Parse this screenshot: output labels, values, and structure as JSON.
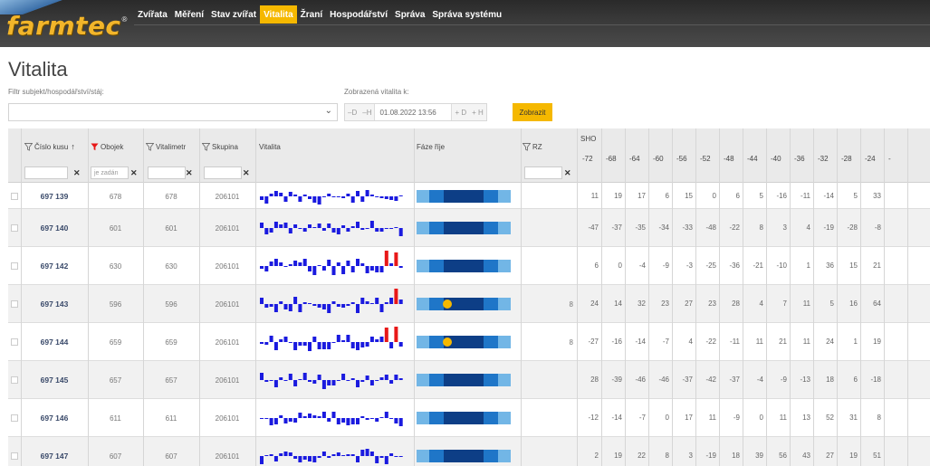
{
  "app": {
    "logo": "farmtec",
    "logo_mark": "®"
  },
  "nav": [
    {
      "label": "Zvířata",
      "active": false
    },
    {
      "label": "Měření",
      "active": false
    },
    {
      "label": "Stav zvířat",
      "active": false
    },
    {
      "label": "Vitalita",
      "active": true
    },
    {
      "label": "Žraní",
      "active": false
    },
    {
      "label": "Hospodářství",
      "active": false
    },
    {
      "label": "Správa",
      "active": false
    },
    {
      "label": "Správa systému",
      "active": false
    }
  ],
  "page": {
    "title": "Vitalita",
    "filter_label": "Filtr subjekt/hospodářství/stáj:",
    "filter_value": "",
    "shown_label": "Zobrazená vitalita k:",
    "date_prev_day": "D",
    "date_prev_hour": "H",
    "date_value": "01.08.2022 13:56",
    "date_next_day": "+ D",
    "date_next_hour": "+ H",
    "show_button": "Zobrazit"
  },
  "table": {
    "headers": {
      "id": "Číslo kusu",
      "sort_arrow": "↑",
      "collar": "Obojek",
      "vitalimeter": "Vitalimetr",
      "group": "Skupina",
      "vitality": "Vitalita",
      "phase": "Fáze říje",
      "rz": "RZ",
      "sho": "SHO"
    },
    "filters": {
      "id": "",
      "collar": "je zadán",
      "vitalimeter": "",
      "group": "",
      "rz": ""
    },
    "sho_columns": [
      "-72",
      "-68",
      "-64",
      "-60",
      "-56",
      "-52",
      "-48",
      "-44",
      "-40",
      "-36",
      "-32",
      "-28",
      "-24",
      "-"
    ],
    "rows": [
      {
        "id": "697 139",
        "collar": "678",
        "vitalimeter": "678",
        "group": "206101",
        "rz": "",
        "dot": false,
        "sho": [
          "11",
          "19",
          "17",
          "6",
          "15",
          "0",
          "6",
          "5",
          "-16",
          "-11",
          "-14",
          "5",
          "33"
        ]
      },
      {
        "id": "697 140",
        "collar": "601",
        "vitalimeter": "601",
        "group": "206101",
        "rz": "",
        "dot": false,
        "sho": [
          "-47",
          "-37",
          "-35",
          "-34",
          "-33",
          "-48",
          "-22",
          "8",
          "3",
          "4",
          "-19",
          "-28",
          "-8"
        ]
      },
      {
        "id": "697 142",
        "collar": "630",
        "vitalimeter": "630",
        "group": "206101",
        "rz": "",
        "dot": false,
        "sho": [
          "6",
          "0",
          "-4",
          "-9",
          "-3",
          "-25",
          "-36",
          "-21",
          "-10",
          "1",
          "36",
          "15",
          "21"
        ]
      },
      {
        "id": "697 143",
        "collar": "596",
        "vitalimeter": "596",
        "group": "206101",
        "rz": "8",
        "dot": true,
        "sho": [
          "24",
          "14",
          "32",
          "23",
          "27",
          "23",
          "28",
          "4",
          "7",
          "11",
          "5",
          "16",
          "64"
        ]
      },
      {
        "id": "697 144",
        "collar": "659",
        "vitalimeter": "659",
        "group": "206101",
        "rz": "8",
        "dot": true,
        "sho": [
          "-27",
          "-16",
          "-14",
          "-7",
          "4",
          "-22",
          "-11",
          "11",
          "21",
          "11",
          "24",
          "1",
          "19"
        ]
      },
      {
        "id": "697 145",
        "collar": "657",
        "vitalimeter": "657",
        "group": "206101",
        "rz": "",
        "dot": false,
        "sho": [
          "28",
          "-39",
          "-46",
          "-46",
          "-37",
          "-42",
          "-37",
          "-4",
          "-9",
          "-13",
          "18",
          "6",
          "-18"
        ]
      },
      {
        "id": "697 146",
        "collar": "611",
        "vitalimeter": "611",
        "group": "206101",
        "rz": "",
        "dot": false,
        "sho": [
          "-12",
          "-14",
          "-7",
          "0",
          "17",
          "11",
          "-9",
          "0",
          "11",
          "13",
          "52",
          "31",
          "8"
        ]
      },
      {
        "id": "697 147",
        "collar": "607",
        "vitalimeter": "607",
        "group": "206101",
        "rz": "",
        "dot": false,
        "sho": [
          "2",
          "19",
          "22",
          "8",
          "3",
          "-19",
          "18",
          "39",
          "56",
          "43",
          "27",
          "19",
          "51"
        ]
      }
    ]
  },
  "colors": {
    "accent": "#f5b800",
    "bar_blue": "#1a1adf",
    "bar_red": "#e81818",
    "phase_dark": "#0d3e86",
    "phase_mid": "#1f76c8",
    "phase_light": "#72b6e6",
    "dot": "#f5b800"
  }
}
